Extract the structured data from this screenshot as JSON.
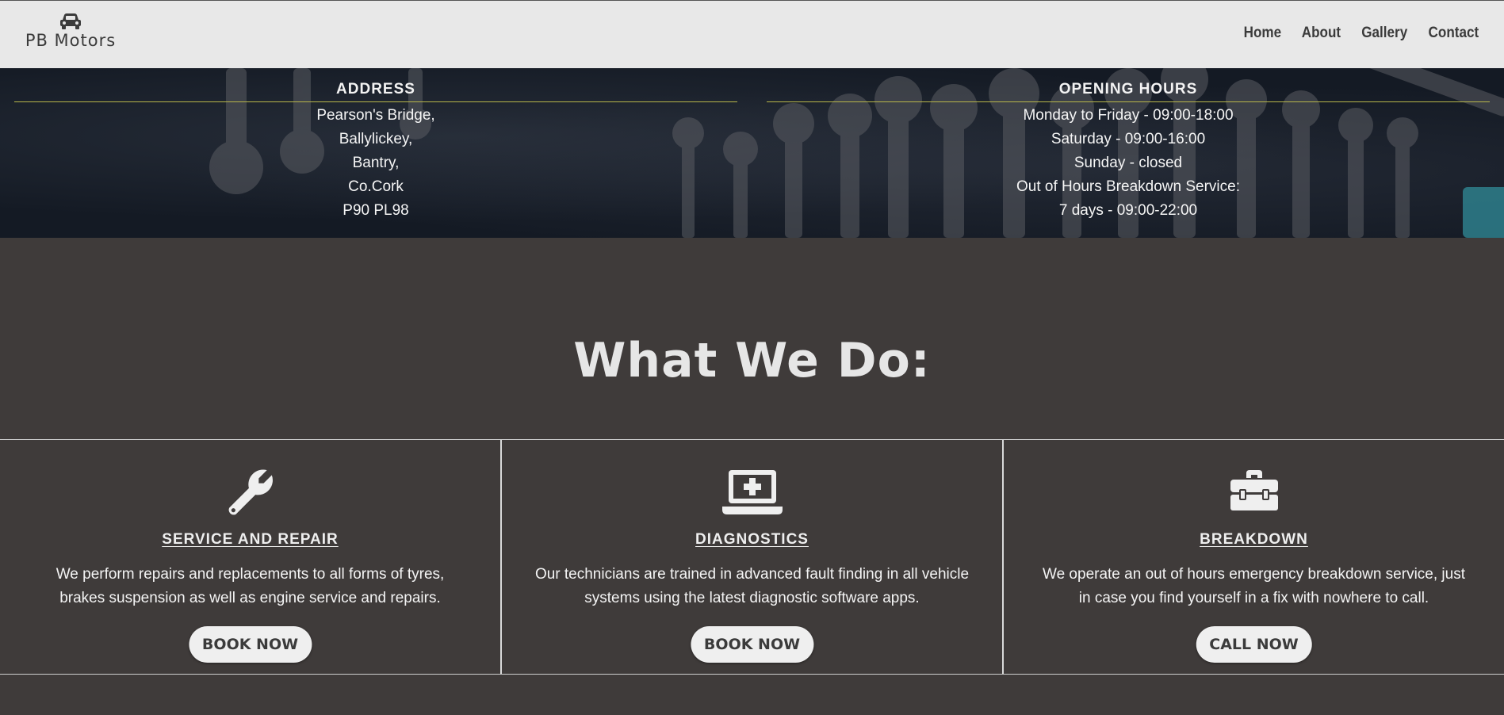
{
  "header": {
    "brand": "PB Motors",
    "nav": [
      "Home",
      "About",
      "Gallery",
      "Contact"
    ]
  },
  "address": {
    "heading": "ADDRESS",
    "lines": [
      "Pearson's Bridge,",
      "Ballylickey,",
      "Bantry,",
      "Co.Cork",
      "P90 PL98"
    ]
  },
  "hours": {
    "heading": "OPENING HOURS",
    "lines": [
      "Monday to Friday - 09:00-18:00",
      "Saturday - 09:00-16:00",
      "Sunday - closed",
      "Out of Hours Breakdown Service:",
      "7 days - 09:00-22:00"
    ]
  },
  "section": {
    "title": "What We Do:"
  },
  "cards": [
    {
      "icon": "wrench-icon",
      "title": "SERVICE AND REPAIR",
      "text": "We perform repairs and replacements to all forms of tyres, brakes suspension as well as engine service and repairs.",
      "button": "BOOK NOW"
    },
    {
      "icon": "laptop-medical-icon",
      "title": "DIAGNOSTICS",
      "text": "Our technicians are trained in advanced fault finding in all vehicle systems using the latest diagnostic software apps.",
      "button": "BOOK NOW"
    },
    {
      "icon": "toolbox-icon",
      "title": "BREAKDOWN",
      "text": "We operate an out of hours emergency breakdown service, just in case you find yourself in a fix with nowhere to call.",
      "button": "CALL NOW"
    }
  ],
  "colors": {
    "header_bg": "#e8e8e8",
    "page_bg": "#3f3b3a",
    "accent_rule": "#b8b64a",
    "button_bg": "#efefef"
  }
}
